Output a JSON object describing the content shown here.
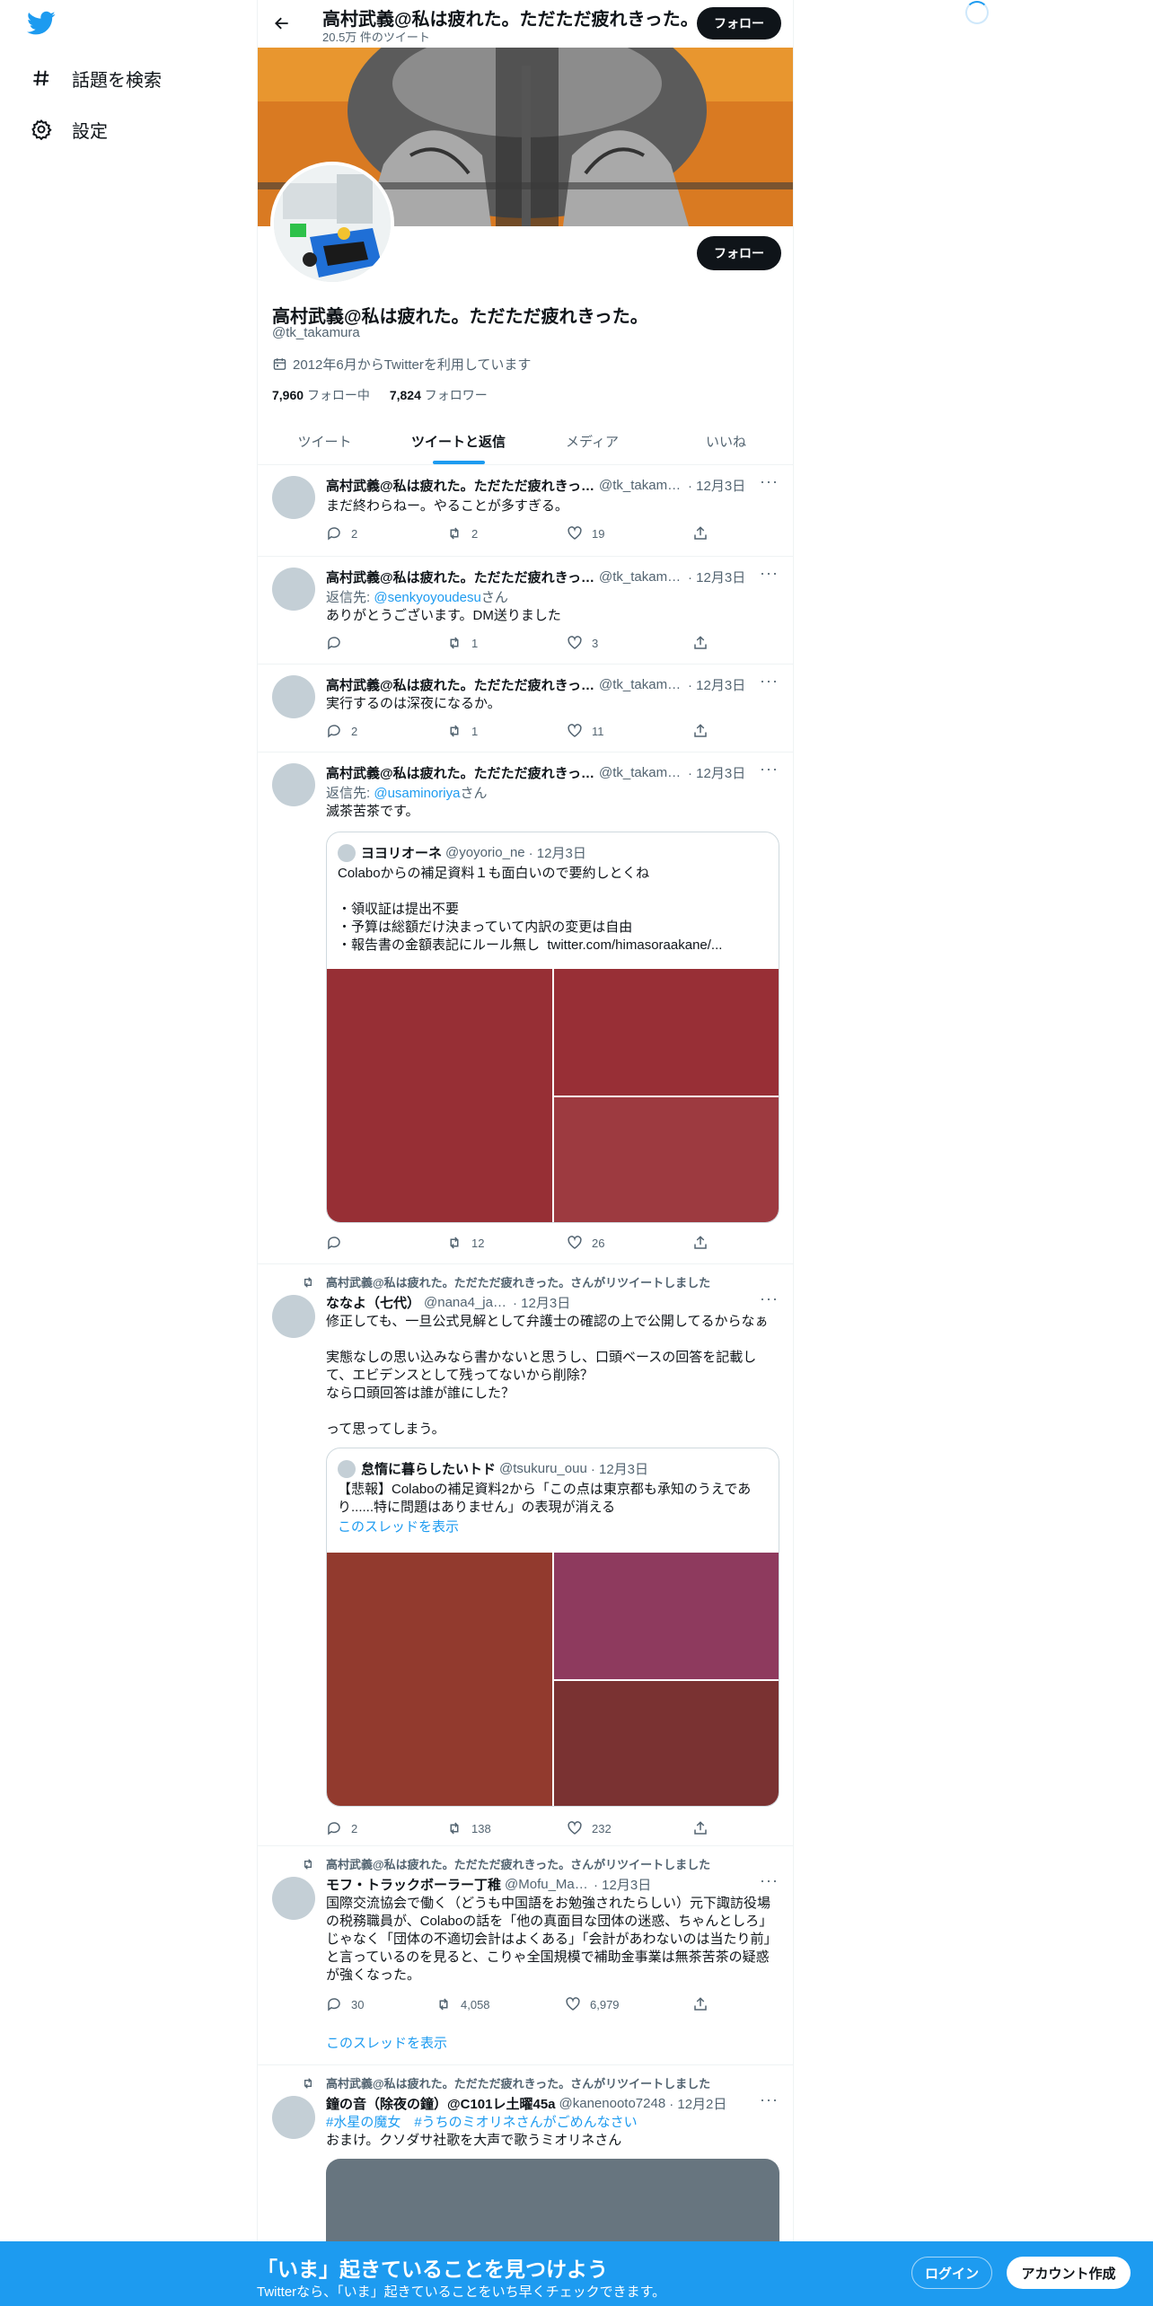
{
  "nav": {
    "logo": "twitter-bird-icon",
    "explore_label": "話題を検索",
    "settings_label": "設定"
  },
  "header": {
    "title": "高村武義@私は疲れた。ただただ疲れきった。",
    "tweet_count": "20.5万 件のツイート",
    "follow_label": "フォロー"
  },
  "profile": {
    "name": "高村武義@私は疲れた。ただただ疲れきった。",
    "handle": "@tk_takamura",
    "joined": "2012年6月からTwitterを利用しています",
    "following_count": "7,960",
    "following_label": "フォロー中",
    "followers_count": "7,824",
    "followers_label": "フォロワー",
    "follow_label": "フォロー"
  },
  "tabs": [
    {
      "label": "ツイート",
      "active": false
    },
    {
      "label": "ツイートと返信",
      "active": true
    },
    {
      "label": "メディア",
      "active": false
    },
    {
      "label": "いいね",
      "active": false
    }
  ],
  "tweets": [
    {
      "name": "高村武義@私は疲れた。ただただ疲れきった。",
      "handle": "@tk_takamura",
      "date": "· 12月3日",
      "text": "まだ終わらねー。やることが多すぎる。",
      "replies": "2",
      "retweets": "2",
      "likes": "19"
    },
    {
      "name": "高村武義@私は疲れた。ただただ疲れきった。",
      "handle": "@tk_takamura",
      "date": "· 12月3日",
      "reply_prefix": "返信先: ",
      "reply_to": "@senkyoyoudesu",
      "reply_suffix": "さん",
      "text": "ありがとうございます。DM送りました",
      "replies": "",
      "retweets": "1",
      "likes": "3"
    },
    {
      "name": "高村武義@私は疲れた。ただただ疲れきった。",
      "handle": "@tk_takamura",
      "date": "· 12月3日",
      "text": "実行するのは深夜になるか。",
      "replies": "2",
      "retweets": "1",
      "likes": "11"
    },
    {
      "name": "高村武義@私は疲れた。ただただ疲れきった。",
      "handle": "@tk_takamura",
      "date": "· 12月3日",
      "reply_prefix": "返信先: ",
      "reply_to": "@usaminoriya",
      "reply_suffix": "さん",
      "text": "滅茶苦茶です。",
      "quote": {
        "name": "ヨヨリオーネ",
        "handle": "@yoyorio_ne",
        "date": "· 12月3日",
        "text": "Colaboからの補足資料１も面白いので要約しとくね\n\n・領収証は提出不要\n・予算は総額だけ決まっていて内訳の変更は自由\n・報告書の金額表記にルール無し  twitter.com/himasoraakane/..."
      },
      "replies": "",
      "retweets": "12",
      "likes": "26"
    },
    {
      "retweeted_by": "高村武義@私は疲れた。ただただ疲れきった。さんがリツイートしました",
      "name": "ななよ（七代）",
      "handle": "@nana4_japan",
      "date": "· 12月3日",
      "text": "修正しても、一旦公式見解として弁護士の確認の上で公開してるからなぁ\n\n実態なしの思い込みなら書かないと思うし、口頭ベースの回答を記載して、エビデンスとして残ってないから削除？\nなら口頭回答は誰が誰にした？\n\nって思ってしまう。",
      "quote": {
        "name": "怠惰に暮らしたいトド",
        "handle": "@tsukuru_ouu",
        "date": "· 12月3日",
        "text": "【悲報】Colaboの補足資料2から「この点は東京都も承知のうえであり......特に問題はありません」の表現が消える",
        "thread_link": "このスレッドを表示"
      },
      "replies": "2",
      "retweets": "138",
      "likes": "232"
    },
    {
      "retweeted_by": "高村武義@私は疲れた。ただただ疲れきった。さんがリツイートしました",
      "name": "モフ・トラックボーラー丁稚",
      "handle": "@Mofu_Master",
      "date": "· 12月3日",
      "text": "国際交流協会で働く（どうも中国語をお勉強されたらしい）元下諏訪役場の税務職員が、Colaboの話を「他の真面目な団体の迷惑、ちゃんとしろ」じゃなく「団体の不適切会計はよくある」「会計があわないのは当たり前」と言っているのを見ると、こりゃ全国規模で補助金事業は無茶苦茶の疑惑が強くなった。",
      "replies": "30",
      "retweets": "4,058",
      "likes": "6,979",
      "thread_link": "このスレッドを表示"
    },
    {
      "retweeted_by": "高村武義@私は疲れた。ただただ疲れきった。さんがリツイートしました",
      "name": "鐘の音（除夜の鐘）@C101レ土曜45a",
      "handle": "@kanenooto7248",
      "date": "· 12月2日",
      "hashtags": "#水星の魔女　#うちのミオリネさんがごめんなさい",
      "text": "おまけ。クソダサ社歌を大声で歌うミオリネさん"
    }
  ],
  "bottom_bar": {
    "title": "「いま」起きていることを見つけよう",
    "subtitle": "Twitterなら、「いま」起きていることをいち早くチェックできます。",
    "login_label": "ログイン",
    "signup_label": "アカウント作成"
  },
  "colors": {
    "accent": "#1d9bf0",
    "media_red": "#9a2f36",
    "media_purple": "#8e3a5e"
  }
}
